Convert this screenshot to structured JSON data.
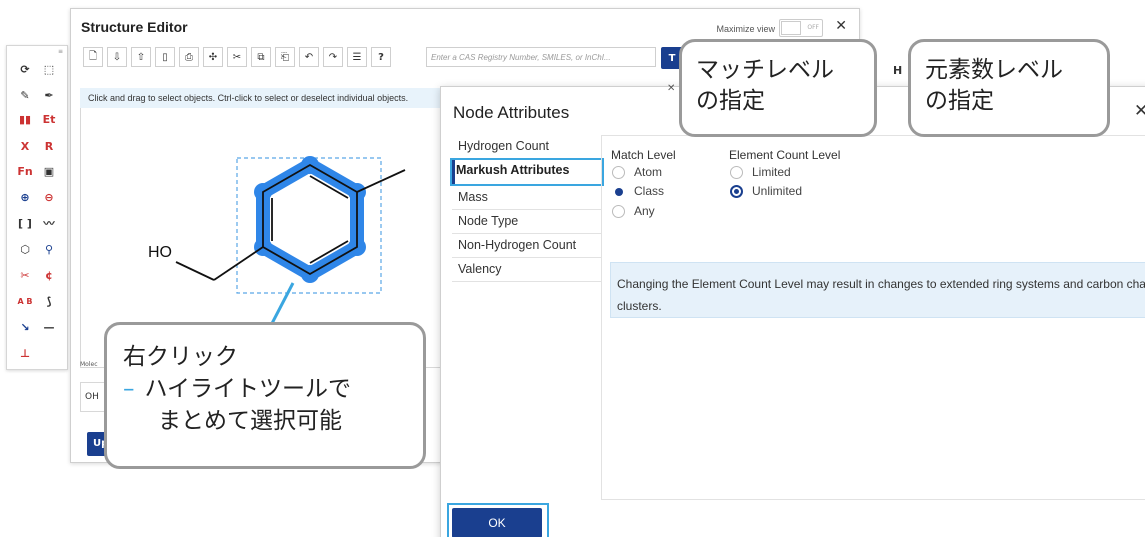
{
  "editor": {
    "title": "Structure Editor",
    "maximize_label": "Maximize view",
    "toggle_state": "OFF",
    "search_placeholder": "Enter a CAS Registry Number, SMILES, or InChI...",
    "go_label": "T",
    "hint": "Click and drag to select objects. Ctrl-click to select or deselect individual objects.",
    "molecule_label": "Molec",
    "smiles_value": "OH",
    "update_label": "Up",
    "atom_label": "HO",
    "right_tool": "H"
  },
  "palette": {
    "buttons": [
      "lasso",
      "select",
      "pencil",
      "pen",
      "bar",
      "Et",
      "X",
      "R",
      "Fn",
      "template",
      "plus",
      "minus",
      "bracket",
      "chain",
      "ring",
      "chain2",
      "cut",
      "charge",
      "AB",
      "arrow",
      "bond",
      "line",
      "axis"
    ],
    "labels": {
      "et": "Et",
      "x": "X",
      "r": "R",
      "fn": "Fn",
      "ab": "A B"
    }
  },
  "dialog": {
    "title": "Node Attributes",
    "nav": [
      {
        "label": "Hydrogen Count",
        "active": false
      },
      {
        "label": "Markush Attributes",
        "active": true
      },
      {
        "label": "Mass",
        "active": false
      },
      {
        "label": "Node Type",
        "active": false
      },
      {
        "label": "Non-Hydrogen Count",
        "active": false
      },
      {
        "label": "Valency",
        "active": false
      }
    ],
    "match_level": {
      "label": "Match Level",
      "options": [
        "Atom",
        "Class",
        "Any"
      ],
      "selected": "Class"
    },
    "element_count_level": {
      "label": "Element Count Level",
      "options": [
        "Limited",
        "Unlimited"
      ],
      "selected": "Unlimited"
    },
    "info": "Changing the Element Count Level may result in changes to extended ring systems and carbon chain clusters.",
    "ok_label": "OK"
  },
  "callouts": {
    "match": [
      "マッチレベル",
      "の指定"
    ],
    "element": [
      "元素数レベル",
      "の指定"
    ],
    "rightclick": {
      "title": "右クリック",
      "dash": "–",
      "lines": [
        "ハイライトツールで",
        "まとめて選択可能"
      ]
    }
  },
  "colors": {
    "accent_blue": "#3aa6e0",
    "highlight_blue": "#2f86e8",
    "primary_navy": "#1a3f8f",
    "callout_border": "#9a9a9a"
  }
}
